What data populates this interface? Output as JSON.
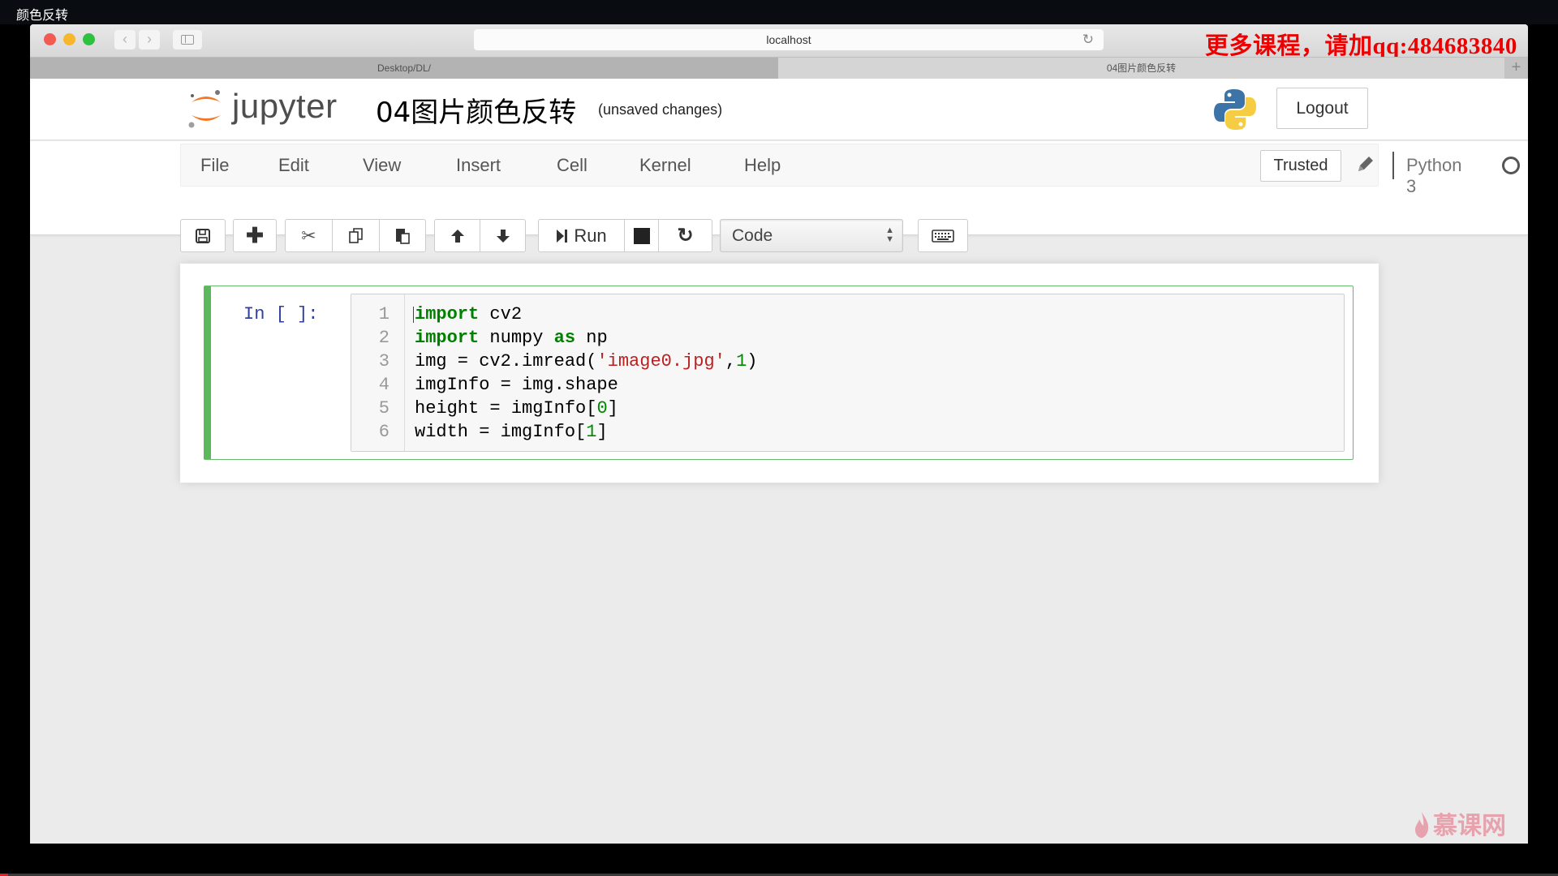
{
  "video": {
    "title": "颜色反转",
    "progress_percent": 0.5
  },
  "browser": {
    "url": "localhost",
    "promo_text": "更多课程，请加qq:484683840",
    "tabs": [
      {
        "label": "Desktop/DL/",
        "active": false
      },
      {
        "label": "04图片颜色反转",
        "active": true
      }
    ],
    "new_tab_label": "+",
    "back_label": "‹",
    "forward_label": "›"
  },
  "header": {
    "logo_text": "jupyter",
    "notebook_name": "04图片颜色反转",
    "save_status": "(unsaved changes)",
    "logout_label": "Logout"
  },
  "menubar": {
    "items": [
      "File",
      "Edit",
      "View",
      "Insert",
      "Cell",
      "Kernel",
      "Help"
    ],
    "trusted_label": "Trusted",
    "kernel_name": "Python 3"
  },
  "toolbar": {
    "run_label": "Run",
    "cell_type": "Code"
  },
  "cell": {
    "prompt": "In [ ]:",
    "line_numbers": [
      "1",
      "2",
      "3",
      "4",
      "5",
      "6"
    ],
    "code": [
      [
        {
          "t": "import",
          "c": "kw"
        },
        {
          "t": " cv2",
          "c": ""
        }
      ],
      [
        {
          "t": "import",
          "c": "kw"
        },
        {
          "t": " numpy ",
          "c": ""
        },
        {
          "t": "as",
          "c": "kw"
        },
        {
          "t": " np",
          "c": ""
        }
      ],
      [
        {
          "t": "img = cv2.imread(",
          "c": ""
        },
        {
          "t": "'image0.jpg'",
          "c": "str"
        },
        {
          "t": ",",
          "c": ""
        },
        {
          "t": "1",
          "c": "num"
        },
        {
          "t": ")",
          "c": ""
        }
      ],
      [
        {
          "t": "imgInfo = img.shape",
          "c": ""
        }
      ],
      [
        {
          "t": "height = imgInfo[",
          "c": ""
        },
        {
          "t": "0",
          "c": "num"
        },
        {
          "t": "]",
          "c": ""
        }
      ],
      [
        {
          "t": "width = imgInfo[",
          "c": ""
        },
        {
          "t": "1",
          "c": "num"
        },
        {
          "t": "]",
          "c": ""
        }
      ]
    ]
  },
  "watermark": {
    "text": "慕课网"
  },
  "colors": {
    "cell_selected": "#5cb85c",
    "promo": "#ee0000",
    "keyword": "#008000",
    "string": "#ba2121",
    "prompt": "#303f9f"
  }
}
